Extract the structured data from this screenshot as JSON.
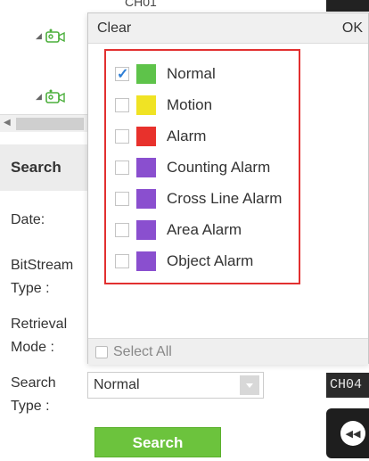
{
  "tree": {
    "top_channel": "CH01",
    "rows": [
      {
        "icon": "camera-icon"
      },
      {
        "icon": "camera-icon"
      }
    ]
  },
  "search_panel": {
    "heading": "Search",
    "labels": {
      "date": "Date:",
      "bitstream_1": "BitStream",
      "bitstream_2": "Type :",
      "retrieval_1": "Retrieval",
      "retrieval_2": "Mode :",
      "search_type_1": "Search",
      "search_type_2": "Type :"
    },
    "search_type_value": "Normal",
    "search_button": "Search"
  },
  "dropdown": {
    "clear": "Clear",
    "ok": "OK",
    "select_all": "Select All",
    "select_all_checked": false,
    "items": [
      {
        "label": "Normal",
        "checked": true,
        "color": "#5ec34a"
      },
      {
        "label": "Motion",
        "checked": false,
        "color": "#f0e324"
      },
      {
        "label": "Alarm",
        "checked": false,
        "color": "#e8312c"
      },
      {
        "label": "Counting Alarm",
        "checked": false,
        "color": "#8a4fcf"
      },
      {
        "label": "Cross Line Alarm",
        "checked": false,
        "color": "#8a4fcf"
      },
      {
        "label": "Area Alarm",
        "checked": false,
        "color": "#8a4fcf"
      },
      {
        "label": "Object Alarm",
        "checked": false,
        "color": "#8a4fcf"
      }
    ]
  },
  "right_panel": {
    "channel": "CH04"
  }
}
